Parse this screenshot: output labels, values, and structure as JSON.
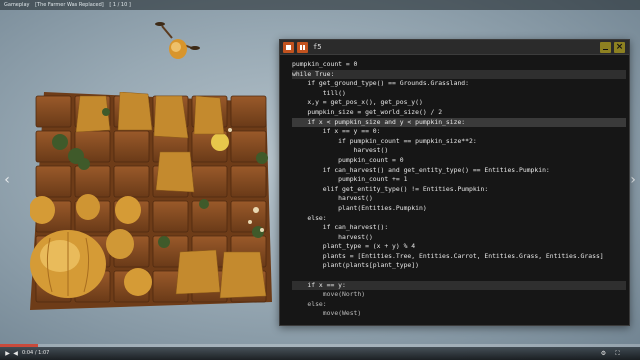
{
  "video": {
    "top_bar_items": [
      "Gameplay",
      "[The Farmer Was Replaced]",
      "[ 1 / 10 ]"
    ],
    "time": "0:04 / 1:07",
    "progress": 0.06
  },
  "editor": {
    "title": "f5",
    "colors": {
      "window_bg": "#161616",
      "titlebar": "#2b2b2b",
      "run_buttons": "#c2531f",
      "window_buttons": "#8d8121",
      "selection": "#5e5e5e"
    },
    "lines": [
      "pumpkin_count = 0",
      "while True:",
      "    if get_ground_type() == Grounds.Grassland:",
      "        till()",
      "    x,y = get_pos_x(), get_pos_y()",
      "    pumpkin_size = get_world_size() / 2",
      "    if x < pumpkin_size and y < pumpkin_size:",
      "        if x == y == 0:",
      "            if pumpkin_count == pumpkin_size**2:",
      "                harvest()",
      "            pumpkin_count = 0",
      "        if can_harvest() and get_entity_type() == Entities.Pumpkin:",
      "            pumpkin_count += 1",
      "        elif get_entity_type() != Entities.Pumpkin:",
      "            harvest()",
      "            plant(Entities.Pumpkin)",
      "    else:",
      "        if can_harvest():",
      "            harvest()",
      "        plant_type = (x + y) % 4",
      "        plants = [Entities.Tree, Entities.Carrot, Entities.Grass, Entities.Grass]",
      "        plant(plants[plant_type])",
      "",
      "    if x == y:",
      "        move(North)",
      "    else:",
      "        move(West)"
    ]
  },
  "icons": [
    "stop-icon",
    "pause-icon",
    "minimize-icon",
    "close-icon",
    "drone-icon",
    "play-icon",
    "volume-icon",
    "settings-icon",
    "fullscreen-icon",
    "chevron-left-icon",
    "chevron-right-icon"
  ]
}
